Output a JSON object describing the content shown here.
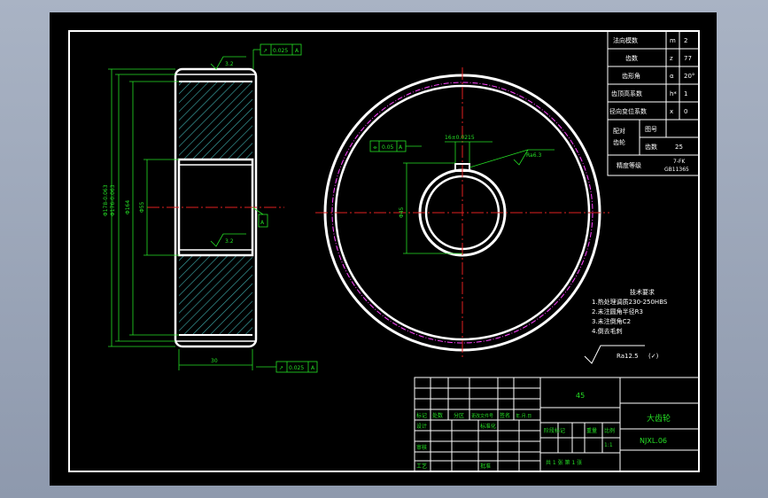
{
  "colors": {
    "background": "#000000",
    "outline": "#ffffff",
    "dimension": "#25e025",
    "centerline": "#e02020",
    "hatch": "#3fb0b0"
  },
  "dims": {
    "d_tip": "Φ178-0.063",
    "d_root": "Φ176-0.063",
    "d_mid": "Φ164",
    "d_hub": "Φ55",
    "width": "30",
    "runout_top": "0.025",
    "runout_bottom": "0.025",
    "tol_top_sym": "↗",
    "tol_bottom_sym": "↗",
    "datum": "A",
    "ra_top": "3.2",
    "ra_bottom": "3.2",
    "datum_letter": "A",
    "keyway": "16±0.0215",
    "sym_tol": "0.05",
    "bore": "Φ45",
    "ra_keyway": "Ra6.3"
  },
  "param_table": [
    {
      "label": "法向模数",
      "sym": "m",
      "val": "2"
    },
    {
      "label": "齿数",
      "sym": "z",
      "val": "77"
    },
    {
      "label": "齿形角",
      "sym": "α",
      "val": "20°"
    },
    {
      "label": "齿顶高系数",
      "sym": "h*",
      "val": "1"
    },
    {
      "label": "径向变位系数",
      "sym": "x",
      "val": "0"
    }
  ],
  "pair_table": {
    "side_label_1": "配对",
    "side_label_2": "齿轮",
    "row1_label": "图号",
    "row1_val": "",
    "row2_label": "齿数",
    "row2_val": "25"
  },
  "precision": {
    "label": "精度等级",
    "val1": "7-FK",
    "val2": "GB11365"
  },
  "tech_req": {
    "title": "技术要求",
    "items": [
      "1.热处理调质230-250HBS",
      "2.未注圆角半径R3",
      "3.未注倒角C2",
      "4.倒去毛刺"
    ],
    "roughness": "Ra12.5",
    "roughness_suffix": "(✓)"
  },
  "title_block": {
    "material": "45",
    "name": "大齿轮",
    "drawing_no": "NJXL.06",
    "scale": "1:1",
    "sheet": "共 1 张  第 1 张",
    "labels": {
      "mark": "标记",
      "count": "处数",
      "zone": "分区",
      "change_doc": "更改文件号",
      "sign": "签名",
      "date": "年.月.日",
      "design": "设计",
      "standard": "标准化",
      "review": "审核",
      "process": "工艺",
      "approve": "批准",
      "stage": "阶段标记",
      "weight": "重量",
      "scale_label": "比例"
    }
  }
}
